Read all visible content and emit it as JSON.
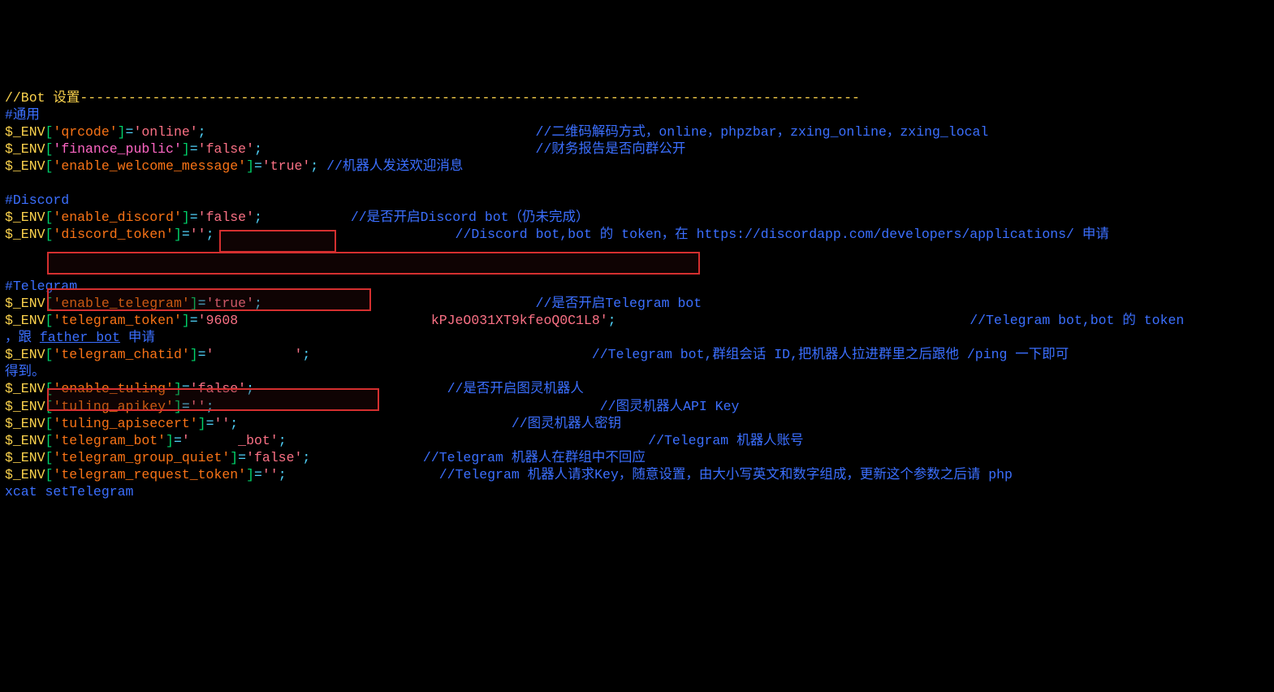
{
  "header": {
    "bot_section": "//Bot 设置-------------------------------------------------------------------------------------------------",
    "general": "#通用"
  },
  "lines": {
    "qrcode": {
      "env": "$_ENV",
      "lb": "[",
      "key": "'qrcode'",
      "rb": "]",
      "eq": "=",
      "val": "'online'",
      "semi": ";",
      "comment": "//二维码解码方式，online，phpzbar，zxing_online，zxing_local"
    },
    "finance_public": {
      "env": "$_ENV",
      "lb": "[",
      "key": "'finance_public'",
      "rb": "]",
      "eq": "=",
      "val": "'false'",
      "semi": ";",
      "comment": "//财务报告是否向群公开"
    },
    "enable_welcome_message": {
      "env": "$_ENV",
      "lb": "[",
      "key": "'enable_welcome_message'",
      "rb": "]",
      "eq": "=",
      "val": "'true'",
      "semi": ";",
      "comment": " //机器人发送欢迎消息"
    },
    "discord_header": "#Discord",
    "enable_discord": {
      "env": "$_ENV",
      "lb": "[",
      "key": "'enable_discord'",
      "rb": "]",
      "eq": "=",
      "val": "'false'",
      "semi": ";",
      "comment": "//是否开启Discord bot（仍未完成）"
    },
    "discord_token": {
      "env": "$_ENV",
      "lb": "[",
      "key": "'discord_token'",
      "rb": "]",
      "eq": "=",
      "val": "''",
      "semi": ";",
      "comment": "//Discord bot,bot 的 token，在 https://discordapp.com/developers/applications/ 申请"
    },
    "telegram_header": "#Telegram",
    "enable_telegram": {
      "env": "$_ENV",
      "lb": "[",
      "key_a": "'enable_telegram'",
      "rb_a": "]",
      "eq": "=",
      "val": "'true'",
      "semi": ";",
      "comment": "//是否开启Telegram bot"
    },
    "telegram_token": {
      "env": "$_ENV",
      "lb": "[",
      "key": "'telegram_token'",
      "rb": "]",
      "eq": "=",
      "val": "'9608                        kPJeO031XT9kfeoQ0C1L8'",
      "semi": ";",
      "comment": "//Telegram bot,bot 的 token"
    },
    "telegram_token_cont": {
      "lead": "，跟 ",
      "father": "father bot",
      "tail": " 申请"
    },
    "telegram_chatid": {
      "env": "$_ENV",
      "lb": "[",
      "key": "'telegram_chatid'",
      "rb": "]",
      "eq": "=",
      "val": "'          '",
      "semi": ";",
      "comment": "//Telegram bot,群组会话 ID,把机器人拉进群里之后跟他 /ping 一下即可"
    },
    "telegram_chatid_cont": "得到。",
    "enable_tuling": {
      "env": "$_ENV",
      "lb": "[",
      "key": "'enable_tuling'",
      "rb": "]",
      "eq": "=",
      "val": "'false'",
      "semi": ";",
      "comment": "//是否开启图灵机器人"
    },
    "tuling_apikey": {
      "env": "$_ENV",
      "lb": "[",
      "key": "'tuling_apikey'",
      "rb": "]",
      "eq": "=",
      "val": "''",
      "semi": ";",
      "comment": "//图灵机器人API Key"
    },
    "tuling_apisecert": {
      "env": "$_ENV",
      "lb": "[",
      "key": "'tuling_apisecert'",
      "rb": "]",
      "eq": "=",
      "val": "''",
      "semi": ";",
      "comment": "//图灵机器人密钥"
    },
    "telegram_bot": {
      "env": "$_ENV",
      "lb": "[",
      "key": "'telegram_bot'",
      "rb": "]",
      "eq": "=",
      "val": "'      _bot'",
      "semi": ";",
      "comment": "//Telegram 机器人账号"
    },
    "telegram_group_quiet": {
      "env": "$_ENV",
      "lb": "[",
      "key": "'telegram_group_quiet'",
      "rb": "]",
      "eq": "=",
      "val": "'false'",
      "semi": ";",
      "comment": "//Telegram 机器人在群组中不回应"
    },
    "telegram_request_token": {
      "env": "$_ENV",
      "lb": "[",
      "key": "'telegram_request_token'",
      "rb": "]",
      "eq": "=",
      "val": "''",
      "semi": ";",
      "comment": "//Telegram 机器人请求Key，随意设置，由大小写英文和数字组成，更新这个参数之后请 php "
    },
    "telegram_request_token_cont": "xcat setTelegram"
  }
}
